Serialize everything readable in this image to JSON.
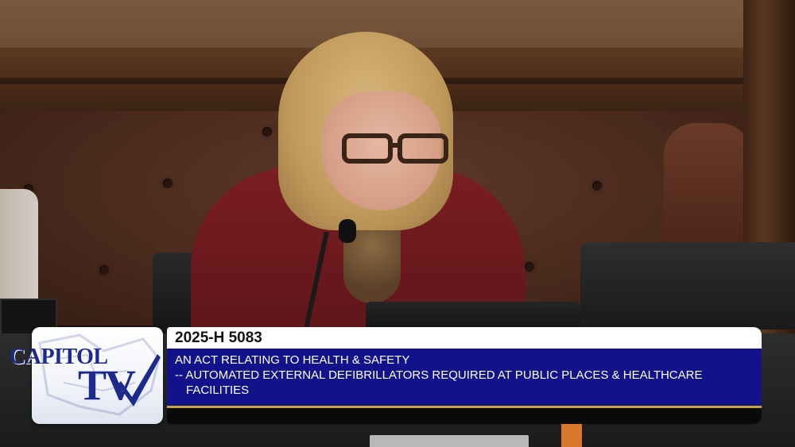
{
  "broadcast": {
    "logo": {
      "line1": "CAPITOL",
      "line2": "TV",
      "mark_icon": "checkmark-icon",
      "brand_color": "#1b2a8c"
    },
    "lower_third": {
      "bill_number": "2025-H 5083",
      "title_line": "AN ACT RELATING TO HEALTH & SAFETY",
      "subtitle_line1": "-- AUTOMATED EXTERNAL DEFIBRILLATORS REQUIRED AT PUBLIC PLACES & HEALTHCARE",
      "subtitle_line2": "FACILITIES",
      "colors": {
        "header_bg": "#ffffff",
        "body_bg": "#12138a",
        "accent": "#c8a43a",
        "footer_bg": "#0a0a0a"
      }
    }
  }
}
